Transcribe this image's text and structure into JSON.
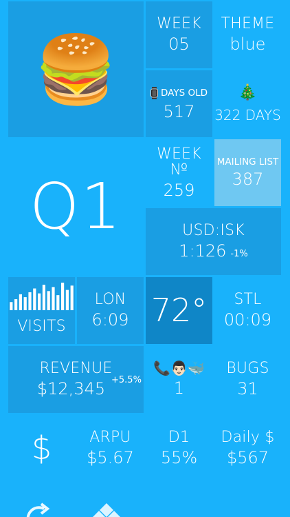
{
  "theme": {
    "background": "#19b2fb",
    "tile_dark": "#1a9ee3",
    "tile_darker": "#0f86c7",
    "tile_light": "#6fc8f2"
  },
  "tiles": {
    "burger": {
      "icon": "hamburger-emoji",
      "glyph": "🍔"
    },
    "week": {
      "label": "WEEK",
      "value": "05"
    },
    "theme": {
      "label": "THEME",
      "value": "blue"
    },
    "days_old": {
      "icon": "watch-icon",
      "label": "DAYS OLD",
      "value": "517"
    },
    "tree_days": {
      "icon": "christmas-tree-emoji",
      "glyph": "🎄",
      "value": "322 DAYS"
    },
    "quarter": {
      "value": "Q1"
    },
    "week_no": {
      "label": "WEEK №",
      "value": "259"
    },
    "mailing_list": {
      "label": "MAILING LIST",
      "value": "387"
    },
    "usd_isk": {
      "label": "USD:ISK",
      "value": "1:126",
      "change": "-1%"
    },
    "visits": {
      "label": "VISITS",
      "bars": [
        0.28,
        0.38,
        0.55,
        0.45,
        0.62,
        0.75,
        0.58,
        0.88,
        0.66,
        0.8,
        0.52,
        0.95,
        0.7,
        0.85
      ]
    },
    "lon": {
      "label": "LON",
      "value": "6:09"
    },
    "temp": {
      "value": "72°"
    },
    "stl": {
      "label": "STL",
      "value": "00:09"
    },
    "revenue": {
      "label": "REVENUE",
      "value": "$12,345",
      "change": "+5.5%"
    },
    "emojis": {
      "glyphs": "📞👨🏻🐳",
      "value": "1"
    },
    "bugs": {
      "label": "BUGS",
      "value": "31"
    },
    "dollar": {
      "glyph": "$"
    },
    "arpu": {
      "label": "ARPU",
      "value": "$5.67"
    },
    "d1": {
      "label": "D1",
      "value": "55%"
    },
    "daily": {
      "label": "Daily $",
      "value": "$567"
    }
  }
}
